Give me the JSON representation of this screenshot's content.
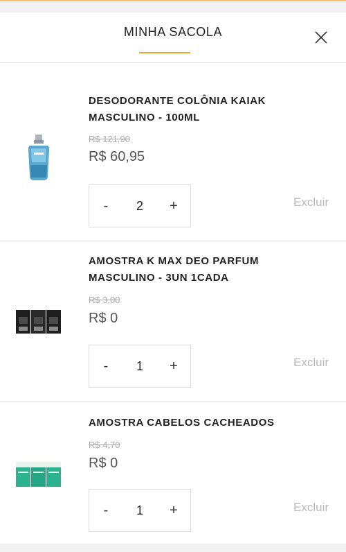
{
  "header": {
    "title": "MINHA SACOLA",
    "accent_color": "#f0a030"
  },
  "close_icon": "close-icon",
  "cart": {
    "items": [
      {
        "name_line1": "DESODORANTE COLÔNIA KAIAK",
        "name_line2": "MASCULINO - 100ML",
        "old_price": "R$ 121,90",
        "price": "R$ 60,95",
        "quantity": "2",
        "remove_label": "Excluir"
      },
      {
        "name_line1": "AMOSTRA K MAX DEO PARFUM",
        "name_line2": "MASCULINO - 3UN 1CADA",
        "old_price": "R$ 3,00",
        "price": "R$ 0",
        "quantity": "1",
        "remove_label": "Excluir"
      },
      {
        "name_line1": "AMOSTRA CABELOS CACHEADOS",
        "name_line2": "",
        "old_price": "R$ 4,70",
        "price": "R$ 0",
        "quantity": "1",
        "remove_label": "Excluir"
      }
    ],
    "minus_symbol": "-",
    "plus_symbol": "+"
  }
}
